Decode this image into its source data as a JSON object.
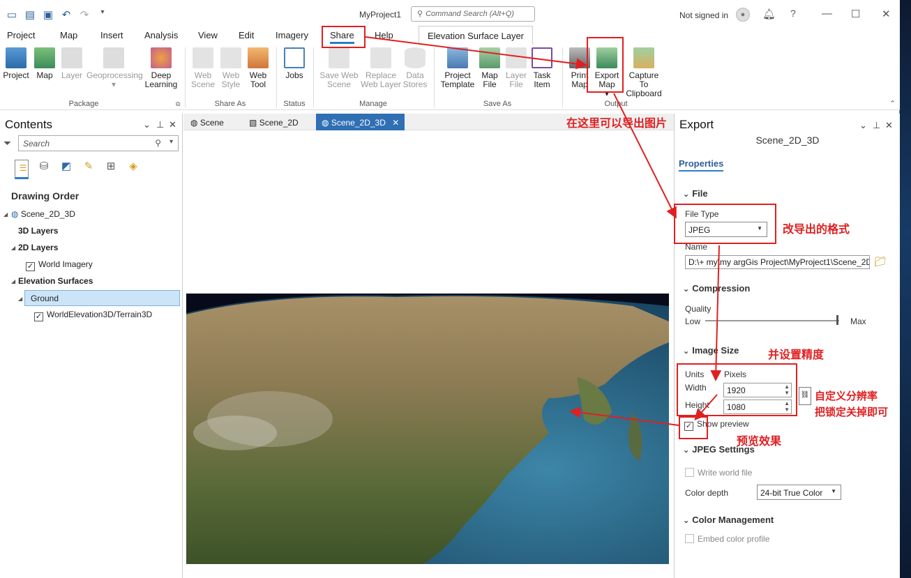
{
  "window": {
    "title": "MyProject1",
    "command_search": "Command Search (Alt+Q)",
    "not_signed_in": "Not signed in"
  },
  "menus": [
    "Project",
    "Map",
    "Insert",
    "Analysis",
    "View",
    "Edit",
    "Imagery",
    "Share",
    "Help"
  ],
  "context_tab": "Elevation Surface Layer",
  "ribbon": {
    "project": "Project",
    "map": "Map",
    "layer": "Layer",
    "geoprocessing": "Geoprocessing",
    "deep_learning": "Deep Learning",
    "web_scene": "Web Scene",
    "web_style": "Web Style",
    "web_tool": "Web Tool",
    "jobs": "Jobs",
    "save_web_scene": "Save Web Scene",
    "replace_web_layer": "Replace Web Layer",
    "data_stores": "Data Stores",
    "project_template": "Project Template",
    "map_file": "Map File",
    "layer_file": "Layer File",
    "task_item": "Task Item",
    "print_map": "Print Map",
    "export_map": "Export Map",
    "capture_clipboard": "Capture To Clipboard",
    "groups": {
      "package": "Package",
      "share_as": "Share As",
      "status": "Status",
      "manage": "Manage",
      "save_as": "Save As",
      "output": "Output"
    }
  },
  "contents": {
    "title": "Contents",
    "search_placeholder": "Search",
    "drawing_order": "Drawing Order",
    "scene": "Scene_2D_3D",
    "layers_3d": "3D Layers",
    "layers_2d": "2D Layers",
    "world_imagery": "World Imagery",
    "elevation_surfaces": "Elevation Surfaces",
    "ground": "Ground",
    "terrain": "WorldElevation3D/Terrain3D"
  },
  "view_tabs": [
    "Scene",
    "Scene_2D",
    "Scene_2D_3D"
  ],
  "export": {
    "title": "Export",
    "scene": "Scene_2D_3D",
    "properties": "Properties",
    "file_section": "File",
    "file_type_label": "File Type",
    "file_type": "JPEG",
    "name_label": "Name",
    "name_value": "D:\\+ my\\my argGis Project\\MyProject1\\Scene_2D",
    "compression": "Compression",
    "quality": "Quality",
    "low": "Low",
    "max": "Max",
    "quality_value": 0.97,
    "image_size": "Image Size",
    "units_label": "Units",
    "units": "Pixels",
    "width_label": "Width",
    "width": "1920",
    "height_label": "Height",
    "height": "1080",
    "show_preview": "Show preview",
    "jpeg_settings": "JPEG Settings",
    "write_world_file": "Write world file",
    "color_depth_label": "Color depth",
    "color_depth": "24-bit True Color",
    "color_management": "Color Management",
    "embed_color_profile": "Embed color profile"
  },
  "annotations": {
    "export_here": "在这里可以导出图片",
    "change_format": "改导出的格式",
    "set_precision": "并设置精度",
    "custom_res": "自定义分辨率",
    "unlock": "把锁定关掉即可",
    "preview": "预览效果"
  },
  "colors": {
    "accent": "#2c7cc7",
    "annotation": "#e02020",
    "active_tab": "#2f6fb4"
  }
}
